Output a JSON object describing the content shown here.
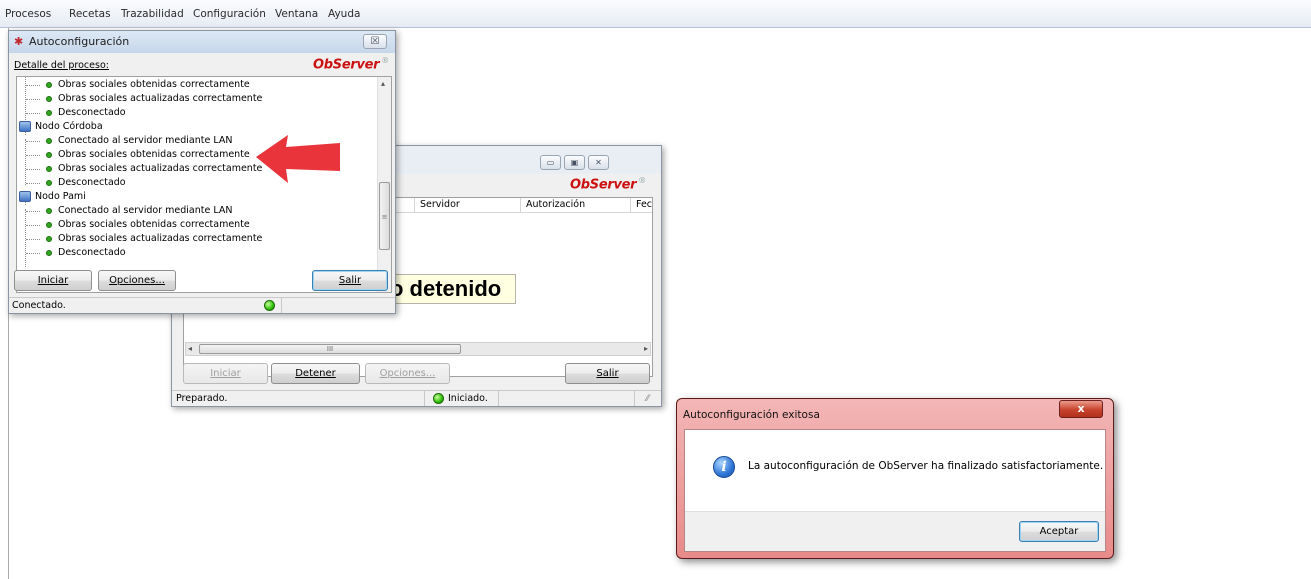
{
  "menu": [
    "Procesos",
    "Recetas",
    "Trazabilidad",
    "Configuración",
    "Ventana",
    "Ayuda"
  ],
  "brand": {
    "logo": "ObServer",
    "mark": "®",
    "color": "#cc1111"
  },
  "main_window": {
    "columns": [
      "Servidor",
      "Autorización",
      "Fecl"
    ],
    "status_banner": "o detenido",
    "scroll_mark": "III",
    "buttons": {
      "iniciar": "Iniciar",
      "detener": "Detener",
      "opciones": "Opciones...",
      "salir": "Salir"
    },
    "status_left": "Preparado.",
    "status_led": "Iniciado."
  },
  "auto_window": {
    "title": "Autoconfiguración",
    "detail_label": "Detalle del proceso:",
    "tree": [
      {
        "type": "item",
        "text": "Obras sociales obtenidas correctamente"
      },
      {
        "type": "item",
        "text": "Obras sociales actualizadas correctamente"
      },
      {
        "type": "item",
        "text": "Desconectado"
      },
      {
        "type": "node",
        "text": "Nodo Córdoba"
      },
      {
        "type": "item",
        "text": "Conectado al servidor mediante LAN"
      },
      {
        "type": "item",
        "text": "Obras sociales obtenidas correctamente"
      },
      {
        "type": "item",
        "text": "Obras sociales actualizadas correctamente"
      },
      {
        "type": "item",
        "text": "Desconectado"
      },
      {
        "type": "node",
        "text": "Nodo Pami"
      },
      {
        "type": "item",
        "text": "Conectado al servidor mediante LAN"
      },
      {
        "type": "item",
        "text": "Obras sociales obtenidas correctamente"
      },
      {
        "type": "item",
        "text": "Obras sociales actualizadas correctamente"
      },
      {
        "type": "item",
        "text": "Desconectado"
      }
    ],
    "buttons": {
      "iniciar": "Iniciar",
      "opciones": "Opciones...",
      "salir": "Salir"
    },
    "status": "Conectado.",
    "close_glyph": "☒"
  },
  "message_box": {
    "title": "Autoconfiguración exitosa",
    "message": "La autoconfiguración de ObServer ha finalizado satisfactoriamente.",
    "ok": "Aceptar",
    "close_glyph": "x",
    "icon": "information-icon"
  },
  "annotation": {
    "arrow_color": "#e8343a"
  }
}
